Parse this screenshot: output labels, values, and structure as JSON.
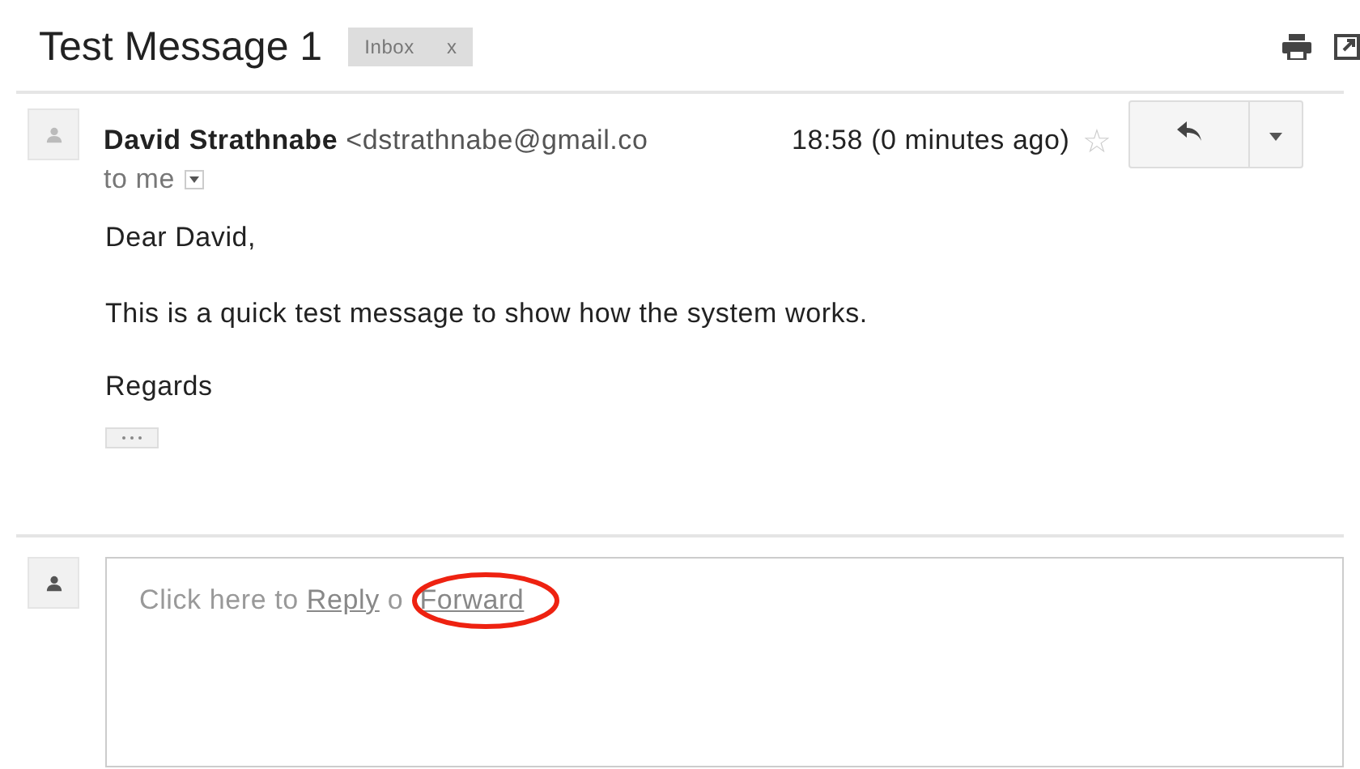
{
  "subject": "Test Message 1",
  "labels": [
    {
      "text": "Inbox",
      "remove": "x"
    }
  ],
  "message": {
    "sender": "David Strathnabe",
    "email": "<dstrathnabe@gmail.co",
    "time": "18:58 (0 minutes ago)",
    "starred": false,
    "star_glyph": "☆",
    "recipient": "to me",
    "body": [
      "Dear David,",
      "This is a quick test message to show how the system works.",
      "Regards"
    ]
  },
  "reply_box": {
    "prefix": "Click here to",
    "reply_link": "Reply",
    "middle": "o",
    "forward_link": "Forward"
  }
}
